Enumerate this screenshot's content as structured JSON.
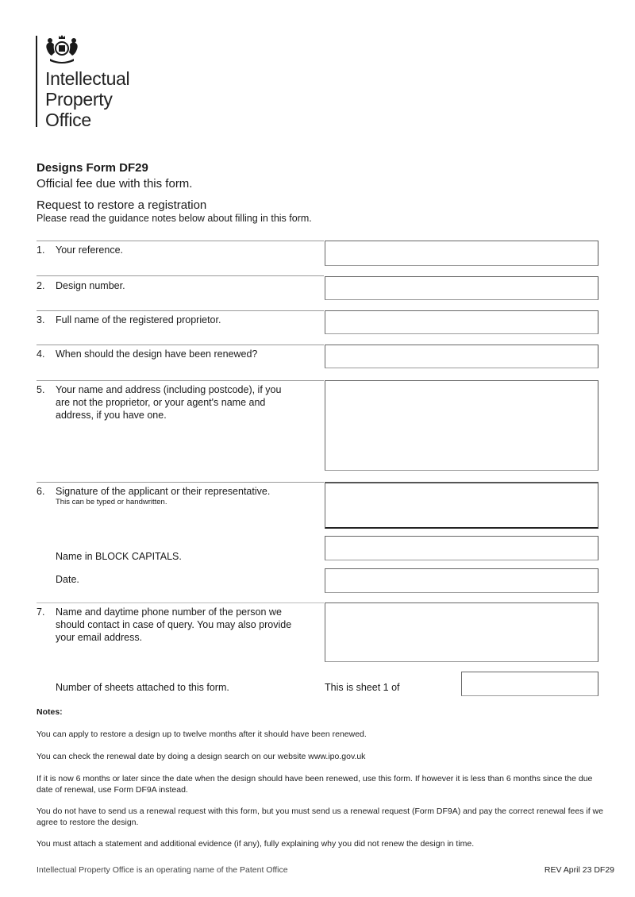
{
  "logo": {
    "emblem": "royal-coat-of-arms",
    "lines": [
      "Intellectual",
      "Property",
      "Office"
    ]
  },
  "header": {
    "form_title": "Designs Form DF29",
    "fee_line": "Official fee due with this form.",
    "request_title": "Request to restore a registration",
    "guidance": "Please read the guidance notes below about filling in this form."
  },
  "questions": [
    {
      "num": "1.",
      "text": "Your reference.",
      "value": ""
    },
    {
      "num": "2.",
      "text": "Design number.",
      "value": ""
    },
    {
      "num": "3.",
      "text": "Full name of the registered proprietor.",
      "value": ""
    },
    {
      "num": "4.",
      "text": "When should the design have been renewed?",
      "value": ""
    },
    {
      "num": "5.",
      "text": "Your name and address (including postcode), if you are not the proprietor, or your agent's name and address, if you have one.",
      "value": ""
    },
    {
      "num": "6.",
      "text": "Signature of the applicant or their representative.",
      "sub": "This can be typed or handwritten.",
      "value": ""
    },
    {
      "num": "7.",
      "text": "Name and daytime phone number of the person we should contact in case of query. You may also provide your email address.",
      "value": ""
    }
  ],
  "extra_fields": {
    "block_capitals_label": "Name in BLOCK CAPITALS.",
    "block_capitals_value": "",
    "date_label": "Date.",
    "date_value": "",
    "sheets_label": "Number of sheets attached to this form.",
    "sheet_of_label": "This is sheet 1 of",
    "sheet_of_value": ""
  },
  "notes": {
    "heading": "Notes:",
    "items": [
      "You can apply to restore a design up to twelve months after it should have been renewed.",
      "You can check the renewal date by doing a design search on our website www.ipo.gov.uk",
      "If it is now 6 months or later since the date when the design should have been renewed, use this form. If however it is less than 6 months since the due date of renewal, use Form DF9A instead.",
      "You do not have to send us a renewal request with this form, but you must send us a renewal request (Form DF9A) and pay the correct renewal fees if we agree to restore the design.",
      "You must attach a statement and additional evidence (if any), fully explaining why you did not renew the design in time."
    ]
  },
  "footer": {
    "left": "Intellectual Property Office is an operating name of the Patent Office",
    "right": "REV April 23 DF29"
  }
}
